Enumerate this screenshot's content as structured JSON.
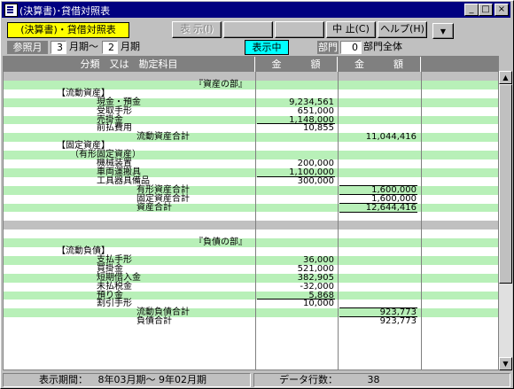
{
  "window": {
    "title": "(決算書)･貸借対照表",
    "buttons": {
      "minimize": "_",
      "maximize": "□",
      "close": "×"
    }
  },
  "toolbar": {
    "report_label": "(決算書)・貸借対照表",
    "display_button": "表 示(I)",
    "blank_button_1": "",
    "blank_button_2": "",
    "stop_button": "中 止(C)",
    "help_button": "ヘルプ(H)",
    "dropdown_arrow": "▼"
  },
  "filter": {
    "period_label": "参照月",
    "from_month": "3",
    "from_suffix": "月期～",
    "to_month": "2",
    "to_suffix": "月期",
    "displaying_badge": "表示中",
    "dept_label": "部門",
    "dept_value": "0",
    "dept_name": "部門全体"
  },
  "grid": {
    "headers": {
      "col1": "分類　又は　勘定科目",
      "col2": "金　　　額",
      "col3": "金　　　額"
    },
    "rows": [
      {
        "label": "",
        "indent": 0,
        "amt1": "",
        "amt2": "",
        "style": "d"
      },
      {
        "label": "『資産の部』",
        "indent": 215,
        "amt1": "",
        "amt2": "",
        "style": "g"
      },
      {
        "label": "【流動資産】",
        "indent": 60,
        "amt1": "",
        "amt2": "",
        "style": "w"
      },
      {
        "label": "現金・預金",
        "indent": 105,
        "amt1": "9,234,561",
        "amt2": "",
        "style": "g"
      },
      {
        "label": "受取手形",
        "indent": 105,
        "amt1": "651,000",
        "amt2": "",
        "style": "w"
      },
      {
        "label": "売掛金",
        "indent": 105,
        "amt1": "1,148,000",
        "amt2": "",
        "style": "g"
      },
      {
        "label": "前払費用",
        "indent": 105,
        "amt1": "10,855",
        "amt2": "",
        "style": "w",
        "u1": true
      },
      {
        "label": "流動資産合計",
        "indent": 150,
        "amt1": "",
        "amt2": "11,044,416",
        "style": "g"
      },
      {
        "label": "【固定資産】",
        "indent": 60,
        "amt1": "",
        "amt2": "",
        "style": "w"
      },
      {
        "label": "（有形固定資産）",
        "indent": 75,
        "amt1": "",
        "amt2": "",
        "style": "g"
      },
      {
        "label": "機械装置",
        "indent": 105,
        "amt1": "200,000",
        "amt2": "",
        "style": "w"
      },
      {
        "label": "車両運搬具",
        "indent": 105,
        "amt1": "1,100,000",
        "amt2": "",
        "style": "g"
      },
      {
        "label": "工具器具備品",
        "indent": 105,
        "amt1": "300,000",
        "amt2": "",
        "style": "w",
        "u1": true
      },
      {
        "label": "有形資産合計",
        "indent": 150,
        "amt1": "",
        "amt2": "1,600,000",
        "style": "g",
        "u2": true
      },
      {
        "label": "固定資産合計",
        "indent": 150,
        "amt1": "",
        "amt2": "1,600,000",
        "style": "w",
        "u2": true
      },
      {
        "label": "資産合計",
        "indent": 150,
        "amt1": "",
        "amt2": "12,644,416",
        "style": "g",
        "u2": true,
        "dbl": true
      },
      {
        "label": "",
        "indent": 0,
        "amt1": "",
        "amt2": "",
        "style": "w"
      },
      {
        "label": "",
        "indent": 0,
        "amt1": "",
        "amt2": "",
        "style": "d"
      },
      {
        "label": "",
        "indent": 0,
        "amt1": "",
        "amt2": "",
        "style": "w"
      },
      {
        "label": "『負債の部』",
        "indent": 215,
        "amt1": "",
        "amt2": "",
        "style": "g"
      },
      {
        "label": "【流動負債】",
        "indent": 60,
        "amt1": "",
        "amt2": "",
        "style": "w"
      },
      {
        "label": "支払手形",
        "indent": 105,
        "amt1": "36,000",
        "amt2": "",
        "style": "g"
      },
      {
        "label": "買掛金",
        "indent": 105,
        "amt1": "521,000",
        "amt2": "",
        "style": "w"
      },
      {
        "label": "短期借入金",
        "indent": 105,
        "amt1": "382,905",
        "amt2": "",
        "style": "g"
      },
      {
        "label": "未払税金",
        "indent": 105,
        "amt1": "-32,000",
        "amt2": "",
        "style": "w"
      },
      {
        "label": "預り金",
        "indent": 105,
        "amt1": "5,868",
        "amt2": "",
        "style": "g"
      },
      {
        "label": "割引手形",
        "indent": 105,
        "amt1": "10,000",
        "amt2": "",
        "style": "w",
        "u1": true
      },
      {
        "label": "流動負債合計",
        "indent": 150,
        "amt1": "",
        "amt2": "923,773",
        "style": "g",
        "u2": true
      },
      {
        "label": "負債合計",
        "indent": 150,
        "amt1": "",
        "amt2": "923,773",
        "style": "w",
        "u2": true
      }
    ]
  },
  "status": {
    "period_label": "表示期間：",
    "period_value": "8年03月期～ 9年02月期",
    "count_label": "データ行数：",
    "count_value": "38"
  },
  "scroll": {
    "up": "▲",
    "down": "▼"
  }
}
